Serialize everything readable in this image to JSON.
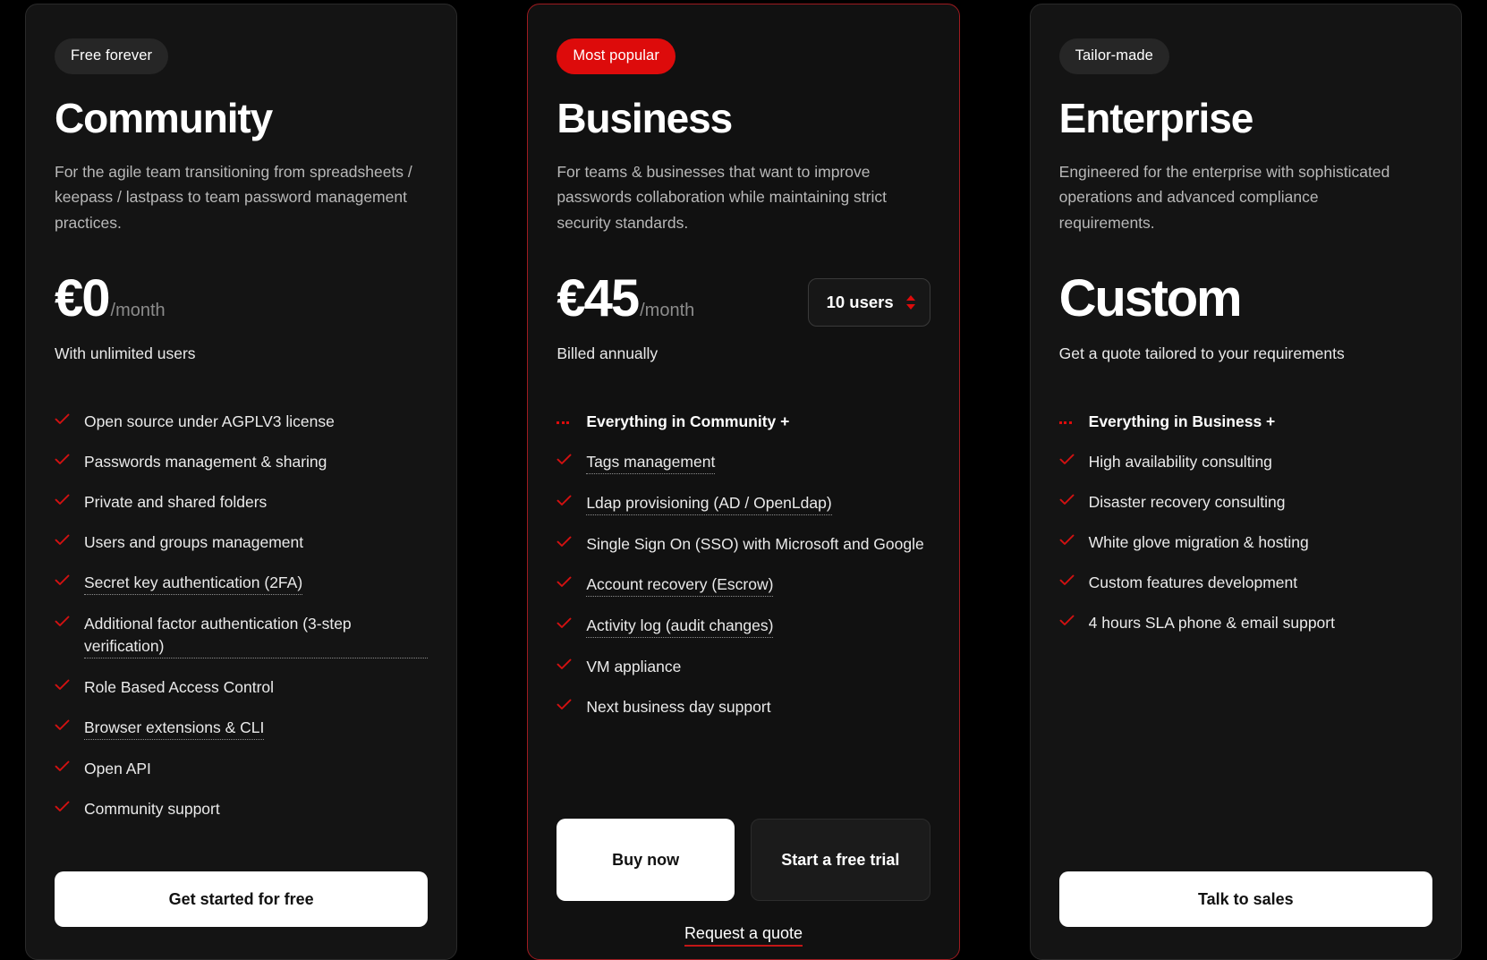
{
  "plans": [
    {
      "badge": "Free forever",
      "badge_accent": false,
      "name": "Community",
      "description": "For the agile team transitioning from spreadsheets / keepass / lastpass to team password management practices.",
      "price_amount": "€0",
      "price_period": "/month",
      "price_sub": "With unlimited users",
      "features": [
        {
          "text": "Open source under AGPLV3 license",
          "icon": "check-icon",
          "tip": false,
          "heading": false
        },
        {
          "text": "Passwords management & sharing",
          "icon": "check-icon",
          "tip": false,
          "heading": false
        },
        {
          "text": "Private and shared folders",
          "icon": "check-icon",
          "tip": false,
          "heading": false
        },
        {
          "text": "Users and groups management",
          "icon": "check-icon",
          "tip": false,
          "heading": false
        },
        {
          "text": "Secret key authentication (2FA)",
          "icon": "check-icon",
          "tip": true,
          "heading": false
        },
        {
          "text": "Additional factor authentication (3-step verification)",
          "icon": "check-icon",
          "tip": true,
          "heading": false
        },
        {
          "text": "Role Based Access Control",
          "icon": "check-icon",
          "tip": false,
          "heading": false
        },
        {
          "text": "Browser extensions & CLI",
          "icon": "check-icon",
          "tip": true,
          "heading": false
        },
        {
          "text": "Open API",
          "icon": "check-icon",
          "tip": false,
          "heading": false
        },
        {
          "text": "Community support",
          "icon": "check-icon",
          "tip": false,
          "heading": false
        }
      ],
      "primary_button": "Get started for free"
    },
    {
      "badge": "Most popular",
      "badge_accent": true,
      "name": "Business",
      "description": "For teams & businesses that want to improve passwords collaboration while maintaining strict security standards.",
      "price_amount": "€45",
      "price_period": "/month",
      "price_sub": "Billed annually",
      "users_stepper_value": "10 users",
      "features": [
        {
          "text": "Everything in Community +",
          "icon": "dots-icon",
          "tip": false,
          "heading": true
        },
        {
          "text": "Tags management",
          "icon": "check-icon",
          "tip": true,
          "heading": false
        },
        {
          "text": "Ldap provisioning (AD / OpenLdap)",
          "icon": "check-icon",
          "tip": true,
          "heading": false
        },
        {
          "text": "Single Sign On (SSO) with Microsoft and Google",
          "icon": "check-icon",
          "tip": false,
          "heading": false
        },
        {
          "text": "Account recovery (Escrow)",
          "icon": "check-icon",
          "tip": true,
          "heading": false
        },
        {
          "text": "Activity log (audit changes)",
          "icon": "check-icon",
          "tip": true,
          "heading": false
        },
        {
          "text": "VM appliance",
          "icon": "check-icon",
          "tip": false,
          "heading": false
        },
        {
          "text": "Next business day support",
          "icon": "check-icon",
          "tip": false,
          "heading": false
        }
      ],
      "primary_button": "Buy now",
      "secondary_button": "Start a free trial",
      "quote_link": "Request a quote"
    },
    {
      "badge": "Tailor-made",
      "badge_accent": false,
      "name": "Enterprise",
      "description": "Engineered for the enterprise with sophisticated operations and advanced compliance requirements.",
      "price_amount": "Custom",
      "price_period": "",
      "price_sub": "Get a quote tailored to your requirements",
      "features": [
        {
          "text": "Everything in Business +",
          "icon": "dots-icon",
          "tip": false,
          "heading": true
        },
        {
          "text": "High availability consulting",
          "icon": "check-icon",
          "tip": false,
          "heading": false
        },
        {
          "text": "Disaster recovery consulting",
          "icon": "check-icon",
          "tip": false,
          "heading": false
        },
        {
          "text": "White glove migration & hosting",
          "icon": "check-icon",
          "tip": false,
          "heading": false
        },
        {
          "text": "Custom features development",
          "icon": "check-icon",
          "tip": false,
          "heading": false
        },
        {
          "text": "4 hours SLA phone & email support",
          "icon": "check-icon",
          "tip": false,
          "heading": false
        }
      ],
      "primary_button": "Talk to sales"
    }
  ],
  "colors": {
    "accent": "#dd0b0b",
    "card_bg": "#141414",
    "page_bg": "#000000",
    "check": "#d41111"
  }
}
